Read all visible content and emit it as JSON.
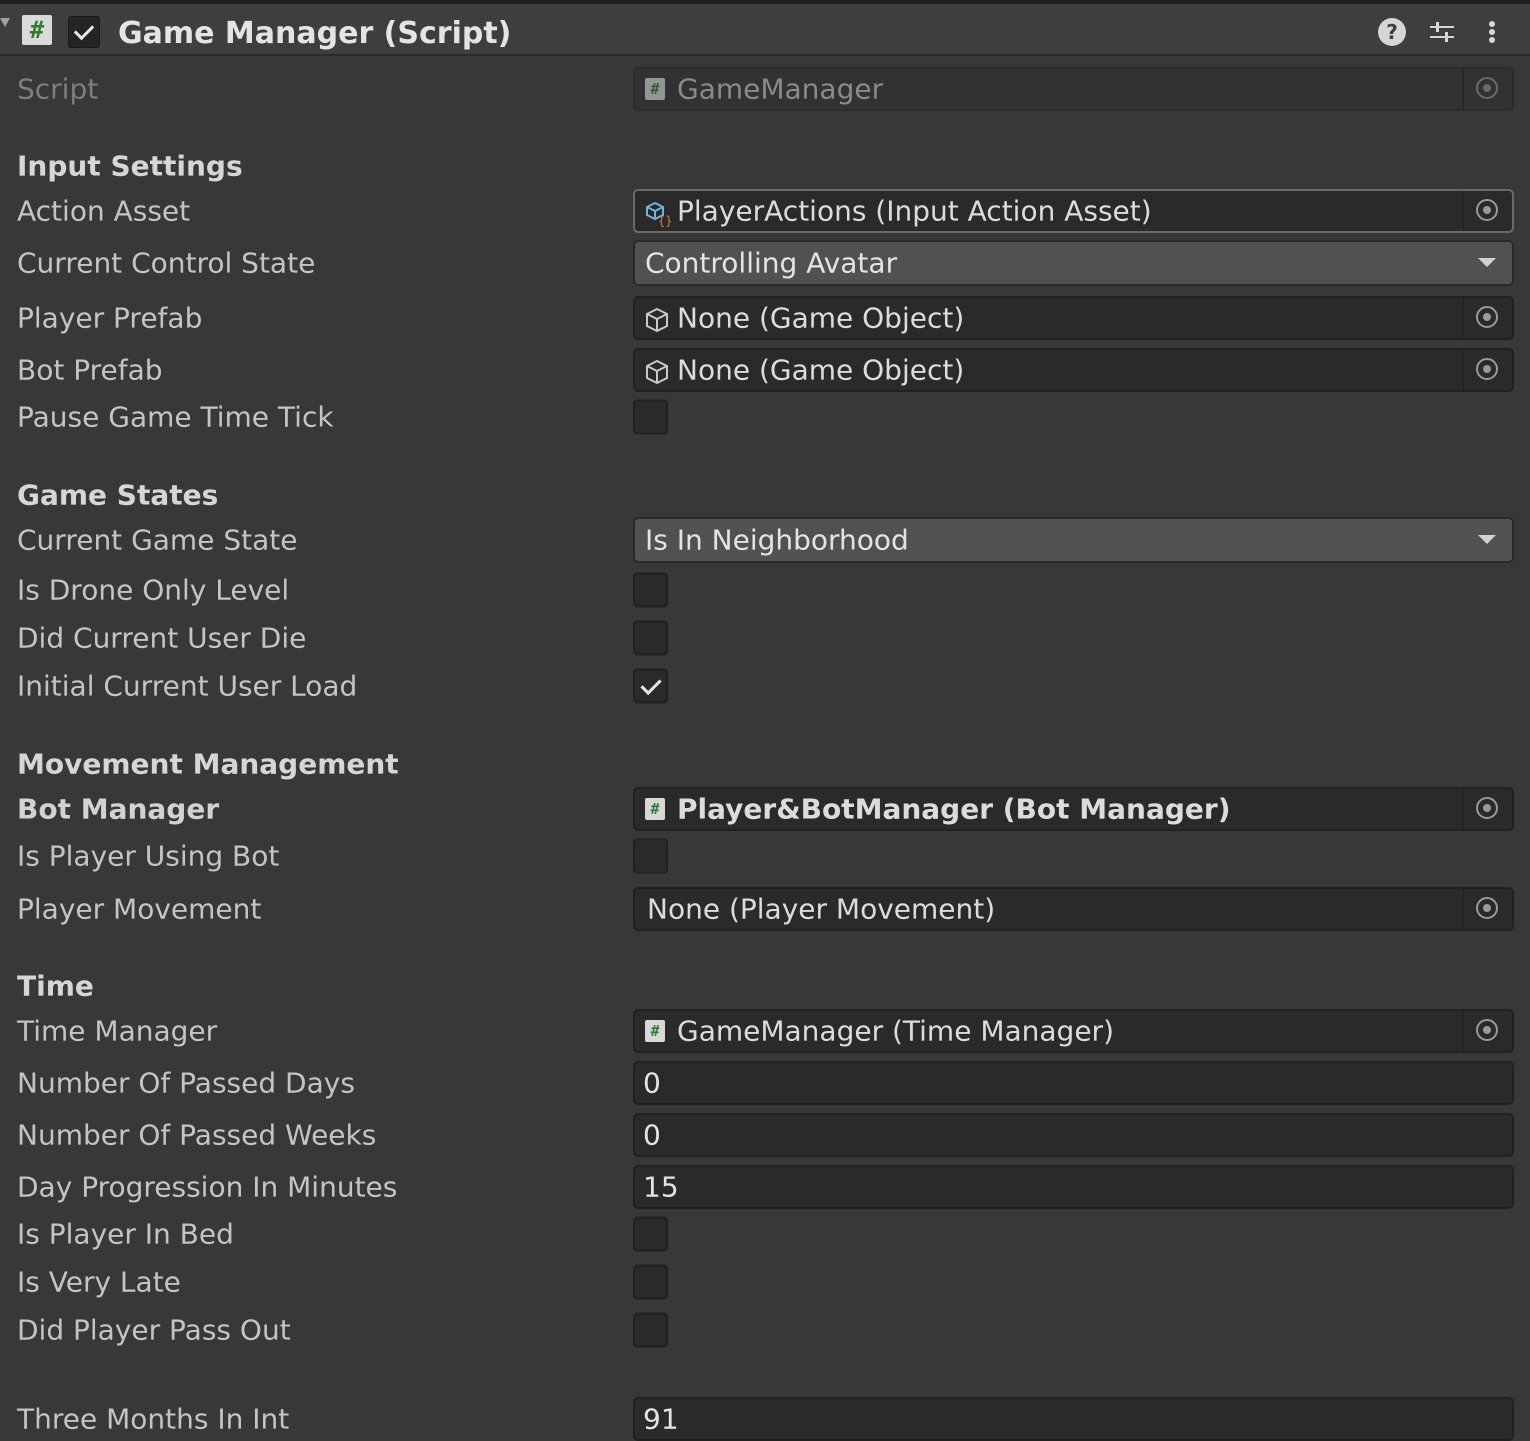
{
  "header": {
    "script_glyph": "#",
    "title": "Game Manager (Script)",
    "help_glyph": "?"
  },
  "script_row": {
    "label": "Script",
    "value": "GameManager",
    "icon_glyph": "#"
  },
  "sections": {
    "input_settings": "Input Settings",
    "game_states": "Game States",
    "movement_management": "Movement Management",
    "time": "Time"
  },
  "fields": {
    "action_asset": {
      "label": "Action Asset",
      "value": "PlayerActions (Input Action Asset)"
    },
    "current_control_state": {
      "label": "Current Control State",
      "value": "Controlling Avatar"
    },
    "player_prefab": {
      "label": "Player Prefab",
      "value": "None (Game Object)"
    },
    "bot_prefab": {
      "label": "Bot Prefab",
      "value": "None (Game Object)"
    },
    "pause_game_time_tick": {
      "label": "Pause Game Time Tick",
      "checked": false
    },
    "current_game_state": {
      "label": "Current Game State",
      "value": "Is In Neighborhood"
    },
    "is_drone_only_level": {
      "label": "Is Drone Only Level",
      "checked": false
    },
    "did_current_user_die": {
      "label": "Did Current User Die",
      "checked": false
    },
    "initial_current_user_load": {
      "label": "Initial Current User Load",
      "checked": true
    },
    "bot_manager": {
      "label": "Bot Manager",
      "value": "Player&BotManager (Bot Manager)",
      "icon_glyph": "#"
    },
    "is_player_using_bot": {
      "label": "Is Player Using Bot",
      "checked": false
    },
    "player_movement": {
      "label": "Player Movement",
      "value": "None (Player Movement)"
    },
    "time_manager": {
      "label": "Time Manager",
      "value": "GameManager (Time Manager)",
      "icon_glyph": "#"
    },
    "number_of_passed_days": {
      "label": "Number Of Passed Days",
      "value": "0"
    },
    "number_of_passed_weeks": {
      "label": "Number Of Passed Weeks",
      "value": "0"
    },
    "day_progression_in_minutes": {
      "label": "Day Progression In Minutes",
      "value": "15"
    },
    "is_player_in_bed": {
      "label": "Is Player In Bed",
      "checked": false
    },
    "is_very_late": {
      "label": "Is Very Late",
      "checked": false
    },
    "did_player_pass_out": {
      "label": "Did Player Pass Out",
      "checked": false
    },
    "three_months_in_int": {
      "label": "Three Months In Int",
      "value": "91"
    }
  },
  "icons": {
    "script": "hash-script-icon",
    "object_picker": "target-circle-icon",
    "input_action_asset": "input-asset-icon",
    "game_object": "cube-icon",
    "dropdown": "triangle-down-icon",
    "help": "help-icon",
    "presets": "sliders-icon",
    "menu": "kebab-menu-icon"
  }
}
